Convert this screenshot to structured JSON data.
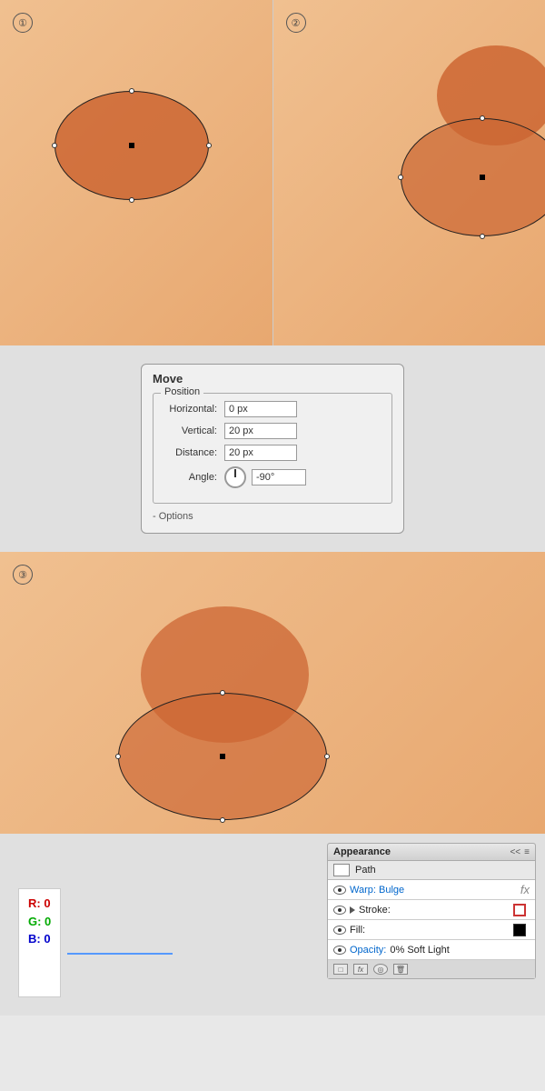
{
  "panels": {
    "step1": "①",
    "step2": "②",
    "step3": "③"
  },
  "move_dialog": {
    "title": "Move",
    "position_legend": "Position",
    "horizontal_label": "Horizontal:",
    "horizontal_value": "0 px",
    "vertical_label": "Vertical:",
    "vertical_value": "20 px",
    "distance_label": "Distance:",
    "distance_value": "20 px",
    "angle_label": "Angle:",
    "angle_value": "-90°",
    "options_label": "- Options"
  },
  "appearance_panel": {
    "title": "Appearance",
    "double_arrow": "<<",
    "menu_icon": "≡",
    "path_label": "Path",
    "warp_bulge": "Warp: Bulge",
    "fx_label": "fx",
    "stroke_label": "Stroke:",
    "fill_label": "Fill:",
    "opacity_label": "Opacity:",
    "opacity_value": "0% Soft Light"
  },
  "rgb": {
    "r_label": "R: 0",
    "g_label": "G: 0",
    "b_label": "B: 0"
  }
}
